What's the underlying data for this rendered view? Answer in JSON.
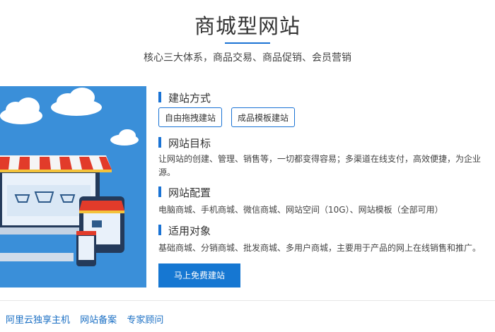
{
  "header": {
    "title": "商城型网站",
    "subtitle": "核心三大体系，商品交易、商品促销、会员营销"
  },
  "sections": {
    "build_method": {
      "heading": "建站方式",
      "options": [
        "自由拖拽建站",
        "成品模板建站"
      ]
    },
    "goal": {
      "heading": "网站目标",
      "line1": "让网站的创建、管理、销售等，一切都变得容易；多渠道在线支付，高效便捷，为企业",
      "line2": "源。"
    },
    "config": {
      "heading": "网站配置",
      "text": "电脑商城、手机商城、微信商城、网站空间（10G）、网站模板（全部可用）"
    },
    "audience": {
      "heading": "适用对象",
      "text": "基础商城、分销商城、批发商城、多用户商城，主要用于产品的网上在线销售和推广。"
    }
  },
  "cta": {
    "label": "马上免费建站"
  },
  "footer_links": [
    "阿里云独享主机",
    "网站备案",
    "专家顾问"
  ],
  "colors": {
    "accent": "#1a73d4",
    "illustration_bg": "#3a8fd9",
    "link": "#1a6fc4"
  }
}
